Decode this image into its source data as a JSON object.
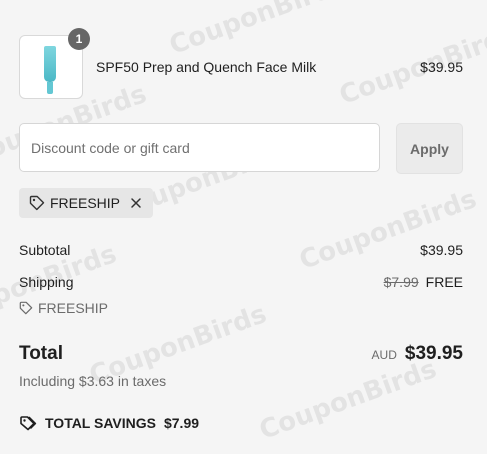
{
  "watermark": "CouponBirds",
  "product": {
    "quantity": "1",
    "name": "SPF50 Prep and Quench Face Milk",
    "price": "$39.95"
  },
  "discount": {
    "placeholder": "Discount code or gift card",
    "apply_label": "Apply",
    "applied_code": "FREESHIP"
  },
  "summary": {
    "subtotal_label": "Subtotal",
    "subtotal_value": "$39.95",
    "shipping_label": "Shipping",
    "shipping_original": "$7.99",
    "shipping_value": "FREE",
    "shipping_code": "FREESHIP",
    "total_label": "Total",
    "currency": "AUD",
    "total_value": "$39.95",
    "taxes_note": "Including $3.63 in taxes",
    "savings_label": "TOTAL SAVINGS",
    "savings_value": "$7.99"
  },
  "colors": {
    "background": "#f5f5f5",
    "thumb_accent": "#4bb8c6",
    "badge": "#666666",
    "chip": "#e6e6e6"
  },
  "icons": [
    "tag-icon",
    "close-icon",
    "tags-icon"
  ]
}
